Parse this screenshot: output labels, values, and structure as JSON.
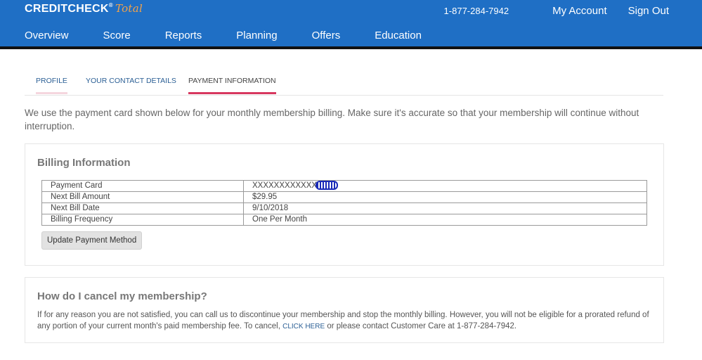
{
  "header": {
    "logo_text": "CREDITCHECK",
    "logo_reg": "®",
    "logo_suffix": "Total",
    "phone": "1-877-284-7942",
    "my_account": "My Account",
    "sign_out": "Sign Out",
    "nav": [
      "Overview",
      "Score",
      "Reports",
      "Planning",
      "Offers",
      "Education"
    ],
    "colors": {
      "bar": "#1f6fc5",
      "logo_accent": "#f2a24a"
    }
  },
  "tabs": [
    {
      "label": "PROFILE",
      "active": false
    },
    {
      "label": "YOUR CONTACT DETAILS",
      "active": false
    },
    {
      "label": "PAYMENT INFORMATION",
      "active": true
    }
  ],
  "intro_text": "We use the payment card shown below for your monthly membership billing. Make sure it's accurate so that your membership will continue without interruption.",
  "billing": {
    "title": "Billing Information",
    "rows": [
      {
        "label": "Payment Card",
        "value": "XXXXXXXXXXXX"
      },
      {
        "label": "Next Bill Amount",
        "value": "$29.95"
      },
      {
        "label": "Next Bill Date",
        "value": "9/10/2018"
      },
      {
        "label": "Billing Frequency",
        "value": "One Per Month"
      }
    ],
    "update_button": "Update Payment Method"
  },
  "cancel": {
    "title": "How do I cancel my membership?",
    "text_before": "If for any reason you are not satisfied, you can call us to discontinue your membership and stop the monthly billing. However, you will not be eligible for a prorated refund of any portion of your current month's paid membership fee. To cancel,",
    "link": "CLICK HERE",
    "text_after": "or please contact Customer Care at 1-877-284-7942."
  }
}
